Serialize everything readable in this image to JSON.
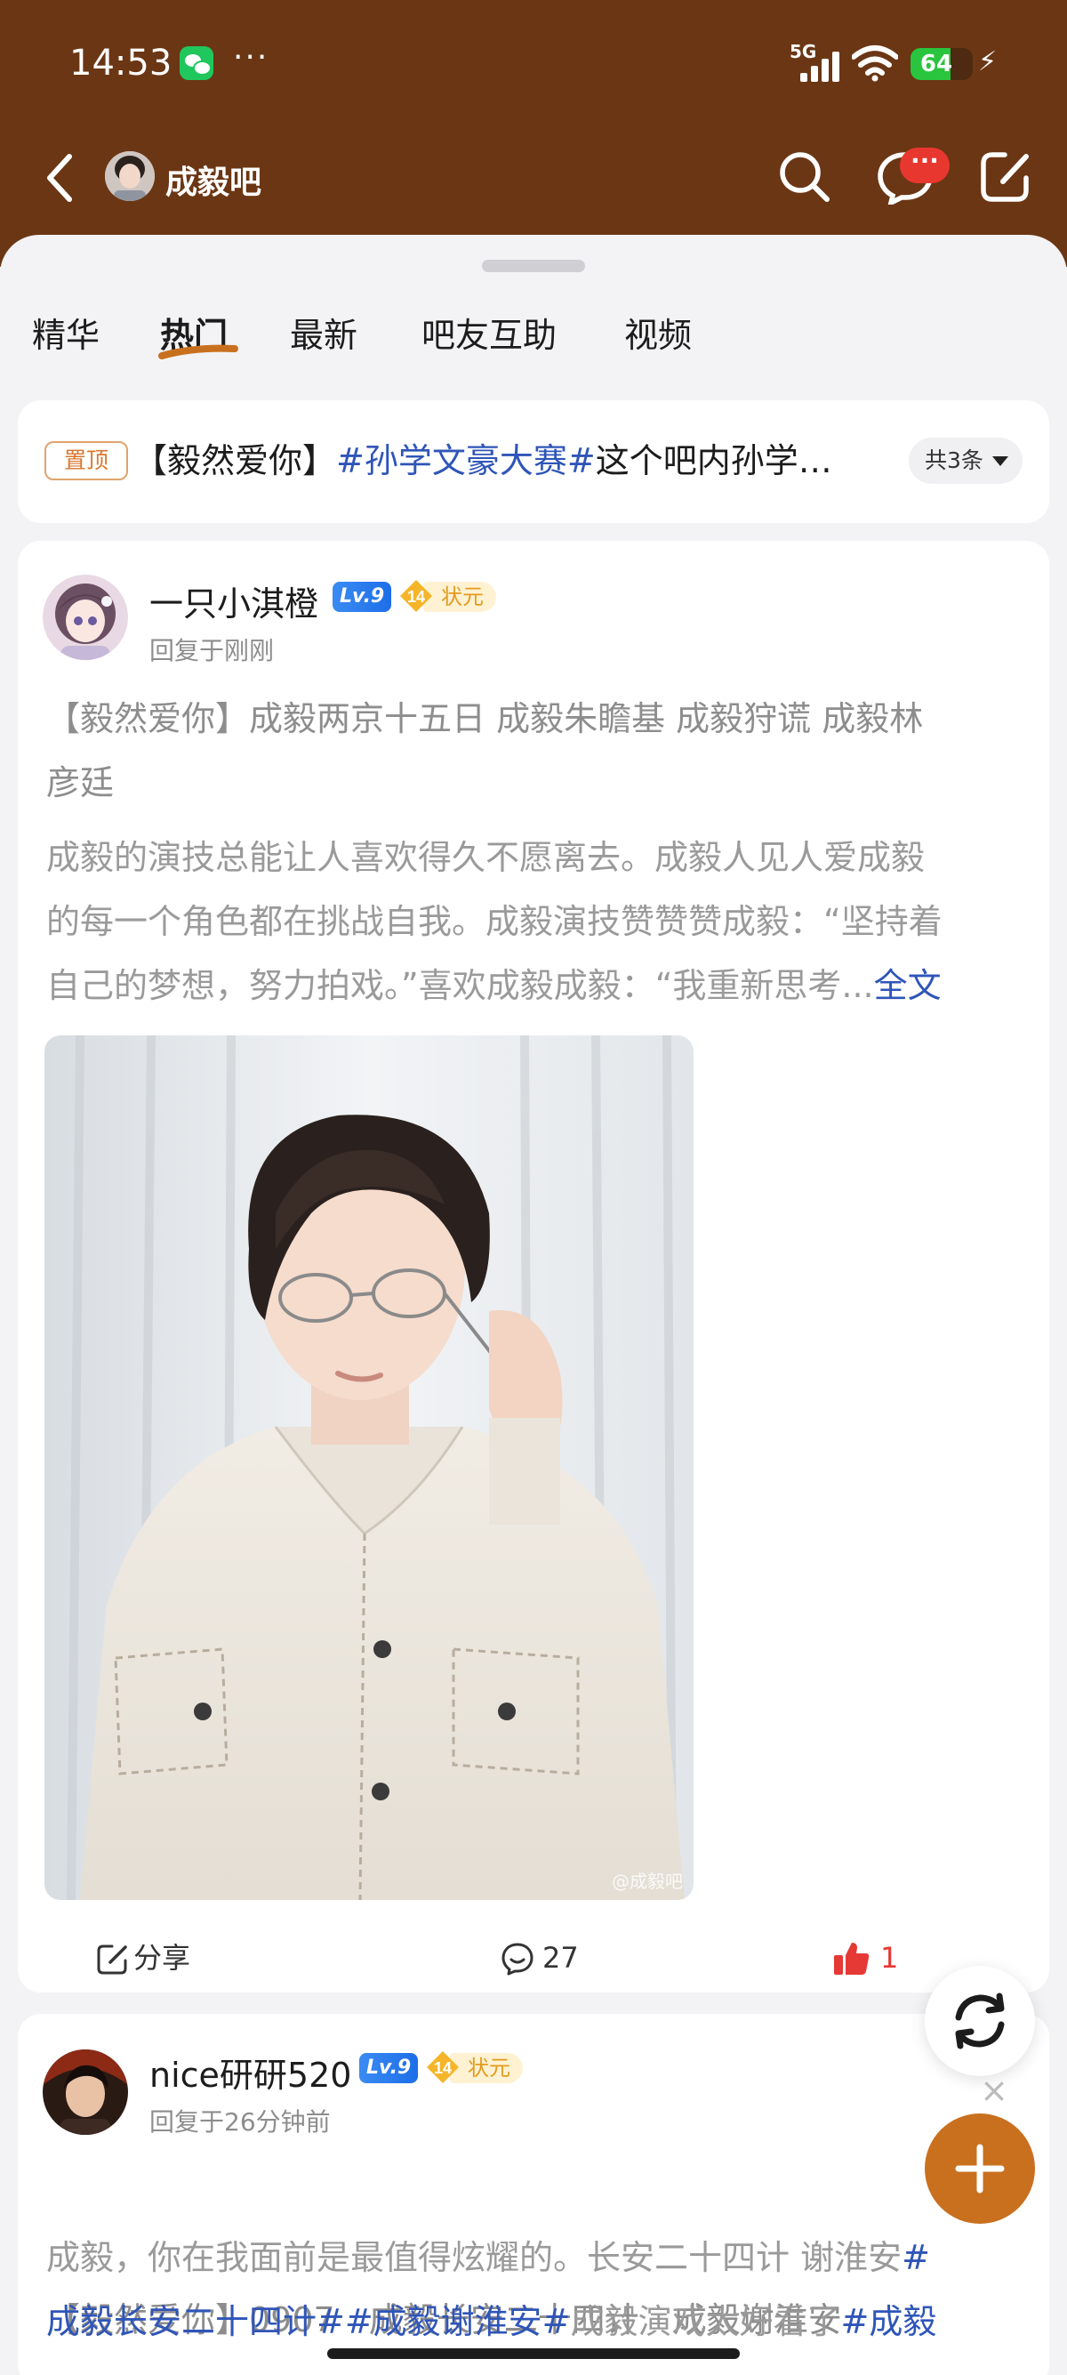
{
  "status_bar": {
    "time": "14:53",
    "app_icon": "wechat-icon",
    "more": "···",
    "network": "5G",
    "battery": "64",
    "battery_level": 0.64,
    "charging_icon": "⚡"
  },
  "top_bar": {
    "back_icon": "chevron-left-icon",
    "bar_name": "成毅吧",
    "search_icon": "search-icon",
    "message_badge": "···",
    "edit_icon": "edit-icon"
  },
  "tabs": [
    {
      "label": "精华",
      "active": false
    },
    {
      "label": "热门",
      "active": true
    },
    {
      "label": "最新",
      "active": false
    },
    {
      "label": "吧友互助",
      "active": false
    },
    {
      "label": "视频",
      "active": false
    }
  ],
  "pinned": {
    "tag": "置顶",
    "title_prefix": "【毅然爱你】",
    "title_hashtag": "#孙学文豪大赛#",
    "title_suffix": "这个吧内孙学…",
    "count": "共3条"
  },
  "posts": [
    {
      "username": "一只小淇橙",
      "level": "Lv.9",
      "rank_num": "14",
      "rank_title": "状元",
      "meta": "回复于刚刚",
      "title_line1": "【毅然爱你】成毅两京十五日 成毅朱瞻基 成毅狩谎 成毅林",
      "title_line2": "彦廷",
      "body_line1": "成毅的演技总能让人喜欢得久不愿离去。成毅人见人爱成毅",
      "body_line2": "的每一个角色都在挑战自我。成毅演技赞赞赞成毅：“坚持着",
      "body_line3": "自己的梦想，努力拍戏。”喜欢成毅成毅：“我重新思考...",
      "full_text_link": "全文",
      "image_watermark": "@成毅吧",
      "share_label": "分享",
      "comment_count": "27",
      "like_count": "1"
    },
    {
      "username": "nice研研520",
      "level": "Lv.9",
      "rank_num": "14",
      "rank_title": "状元",
      "meta": "回复于26分钟前",
      "title_line1": "【毅然爱你】0907　成毅长安二十四计　成毅谢淮安",
      "body_line1": "成毅，你在我面前是最值得炫耀的。长安二十四计 谢淮安",
      "body_line1_hash": "#",
      "body_line2_a": "成毅长安二十四计##成毅谢淮安#",
      "body_line2_b": "成毅演戏太好看了",
      "body_line2_c": "#成毅"
    }
  ],
  "floating": {
    "refresh_icon": "refresh-icon",
    "close_icon": "close-icon",
    "close_glyph": "×",
    "add_icon": "plus-icon"
  },
  "colors": {
    "header_bg": "#6b3614",
    "accent_orange": "#c9701f",
    "link_blue": "#2f55b8",
    "like_red": "#e53935"
  }
}
